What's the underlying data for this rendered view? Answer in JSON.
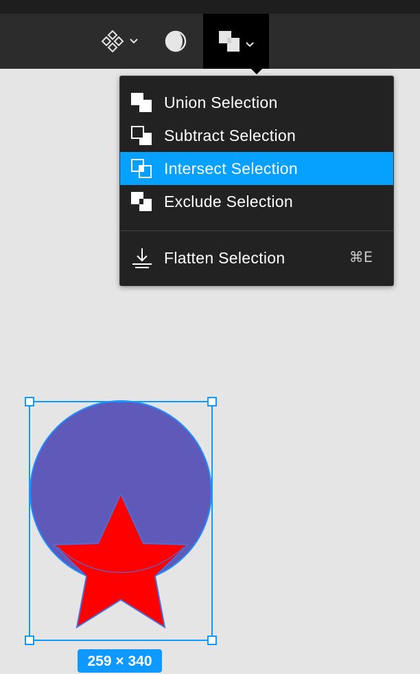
{
  "toolbar": {
    "buttons": [
      {
        "icon": "component-icon",
        "has_dropdown": true
      },
      {
        "icon": "mask-icon",
        "has_dropdown": false
      },
      {
        "icon": "boolean-union-icon",
        "has_dropdown": true,
        "active": true
      }
    ]
  },
  "boolean_menu": {
    "items": [
      {
        "label": "Union Selection",
        "icon": "union-icon"
      },
      {
        "label": "Subtract Selection",
        "icon": "subtract-icon"
      },
      {
        "label": "Intersect Selection",
        "icon": "intersect-icon",
        "highlighted": true
      },
      {
        "label": "Exclude Selection",
        "icon": "exclude-icon"
      }
    ],
    "flatten": {
      "label": "Flatten Selection",
      "shortcut": "⌘E",
      "icon": "flatten-icon"
    }
  },
  "canvas": {
    "selection_size": "259 × 340",
    "colors": {
      "circle_fill": "#5f5ab9",
      "star_fill": "#ff0000",
      "selection": "#0d99ff"
    }
  }
}
